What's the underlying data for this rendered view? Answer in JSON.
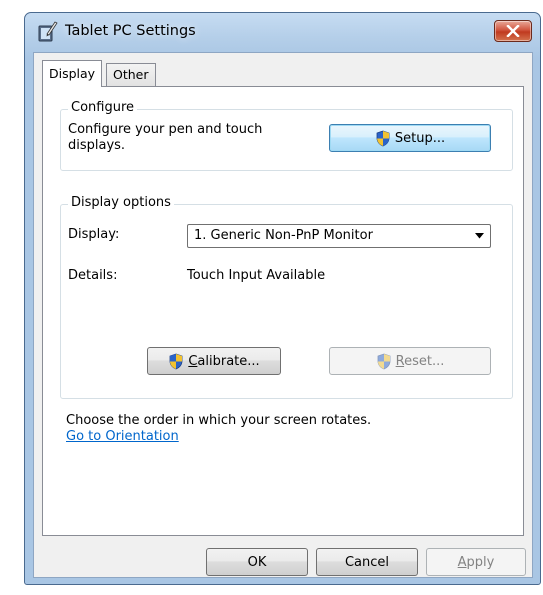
{
  "window": {
    "title": "Tablet PC Settings"
  },
  "tabs": [
    {
      "label": "Display",
      "selected": true
    },
    {
      "label": "Other",
      "selected": false
    }
  ],
  "configure_group": {
    "legend": "Configure",
    "description_line1": "Configure your pen and touch",
    "description_line2": "displays.",
    "setup_button": "Setup..."
  },
  "display_options_group": {
    "legend": "Display options",
    "display_label": "Display:",
    "display_value": "1. Generic Non-PnP Monitor",
    "details_label": "Details:",
    "details_value": "Touch Input Available",
    "calibrate_prefix": "",
    "calibrate_mnemonic": "C",
    "calibrate_rest": "alibrate...",
    "reset_mnemonic": "R",
    "reset_rest": "eset..."
  },
  "orientation": {
    "text": "Choose the order in which your screen rotates.",
    "link": "Go to Orientation"
  },
  "footer": {
    "ok": "OK",
    "cancel": "Cancel",
    "apply_mnemonic": "A",
    "apply_rest": "pply"
  },
  "colors": {
    "link": "#0066cc",
    "close_button": "#c8442b",
    "title_bar": "#b5cfe9"
  }
}
